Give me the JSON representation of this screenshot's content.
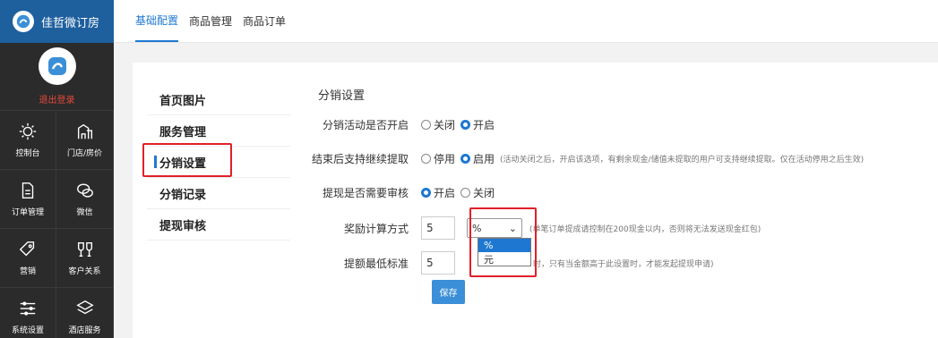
{
  "brand": {
    "name": "佳哲微订房"
  },
  "user": {
    "logout": "退出登录"
  },
  "sidebar": {
    "items": [
      {
        "label": "控制台",
        "icon": "sun-icon"
      },
      {
        "label": "门店/房价",
        "icon": "building-icon"
      },
      {
        "label": "订单管理",
        "icon": "document-icon"
      },
      {
        "label": "微信",
        "icon": "wechat-icon"
      },
      {
        "label": "营销",
        "icon": "tag-icon"
      },
      {
        "label": "客户关系",
        "icon": "glasses-icon"
      },
      {
        "label": "系统设置",
        "icon": "sliders-icon"
      },
      {
        "label": "酒店服务",
        "icon": "layers-icon"
      }
    ]
  },
  "topbar": {
    "tabs": [
      "基础配置",
      "商品管理",
      "商品订单"
    ]
  },
  "subnav": {
    "items": [
      "首页图片",
      "服务管理",
      "分销设置",
      "分销记录",
      "提现审核"
    ]
  },
  "form": {
    "title": "分销设置",
    "row1": {
      "label": "分销活动是否开启",
      "opt1": "关闭",
      "opt2": "开启"
    },
    "row2": {
      "label": "结束后支持继续提取",
      "opt1": "停用",
      "opt2": "启用",
      "hint": "(活动关闭之后，开启该选项，有剩余现金/储值未提取的用户可支持继续提取。仅在活动停用之后生效)"
    },
    "row3": {
      "label": "提现是否需要审核",
      "opt1": "开启",
      "opt2": "关闭"
    },
    "row4": {
      "label": "奖励计算方式",
      "value": "5",
      "select_value": "%",
      "hint": "(单笔订单提成请控制在200现金以内，否则将无法发送现金红包)"
    },
    "row5": {
      "label": "提额最低标准",
      "value": "5",
      "hint": "时，只有当金额高于此设置时，才能发起提现申请)"
    },
    "dropdown_options": [
      "%",
      "元"
    ],
    "save": "保存"
  }
}
